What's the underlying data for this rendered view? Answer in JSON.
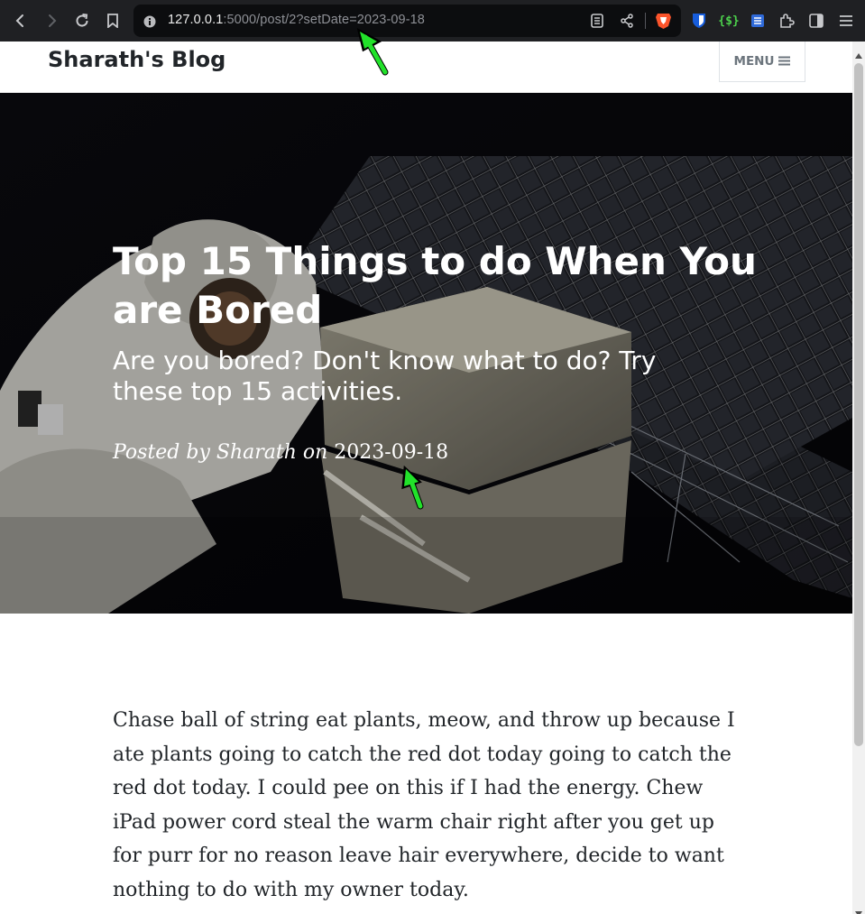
{
  "browser": {
    "url_host": "127.0.0.1",
    "url_rest": ":5000/post/2?setDate=2023-09-18"
  },
  "navbar": {
    "brand": "Sharath's Blog",
    "menu_label": "MENU"
  },
  "post": {
    "title": "Top 15 Things to do When You are Bored",
    "subtitle": "Are you bored? Don't know what to do? Try these top 15 activities.",
    "meta_prefix": "Posted by Sharath on ",
    "date": "2023-09-18",
    "body": "Chase ball of string eat plants, meow, and throw up because I ate plants going to catch the red dot today going to catch the red dot today. I could pee on this if I had the energy. Chew iPad power cord steal the warm chair right after you get up for purr for no reason leave hair everywhere, decide to want nothing to do with my owner today."
  },
  "icons": [
    "back-icon",
    "forward-icon",
    "reload-icon",
    "bookmark-icon",
    "site-info-icon",
    "reader-icon",
    "share-icon",
    "brave-shield-icon",
    "bitwarden-icon",
    "json-extension-icon",
    "notes-extension-icon",
    "extensions-icon",
    "sidebar-icon",
    "browser-menu-icon",
    "hamburger-icon"
  ],
  "colors": {
    "annotation_arrow": "#22e22a",
    "chrome_bg": "#1f2023"
  }
}
